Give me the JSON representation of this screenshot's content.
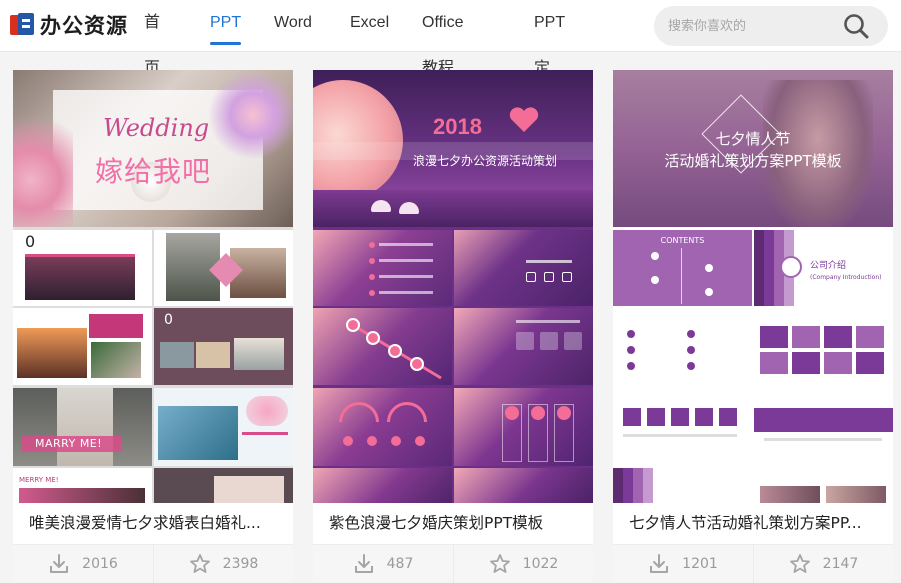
{
  "header": {
    "logo_text": "办公资源",
    "nav": [
      {
        "label": "首页",
        "active": false
      },
      {
        "label": "PPT",
        "active": true
      },
      {
        "label": "Word",
        "active": false
      },
      {
        "label": "Excel",
        "active": false
      },
      {
        "label": "Office教程",
        "active": false
      },
      {
        "label": "PPT定制",
        "active": false
      }
    ],
    "search_placeholder": "搜索你喜欢的"
  },
  "cards": [
    {
      "title": "唯美浪漫爱情七夕求婚表白婚礼...",
      "downloads": "2016",
      "favorites": "2398",
      "cover_script": "Wedding",
      "cover_text": "嫁给我吧",
      "slide_number_1": "0",
      "slide_number_2": "0",
      "marry_text": "MARRY ME!",
      "marry_text_2": "MERRY ME!"
    },
    {
      "title": "紫色浪漫七夕婚庆策划PPT模板",
      "downloads": "487",
      "favorites": "1022",
      "cover_year": "2018",
      "cover_text": "浪漫七夕办公资源活动策划"
    },
    {
      "title": "七夕情人节活动婚礼策划方案PP...",
      "downloads": "1201",
      "favorites": "2147",
      "cover_line1": "七夕情人节",
      "cover_line2": "活动婚礼策划方案PPT模板",
      "contents_label": "CONTENTS",
      "section_title": "公司介绍",
      "section_sub": "(Company Introduction)"
    }
  ],
  "colors": {
    "accent": "#1f75d6",
    "pink": "#e8538a",
    "purple": "#7b3a97"
  }
}
